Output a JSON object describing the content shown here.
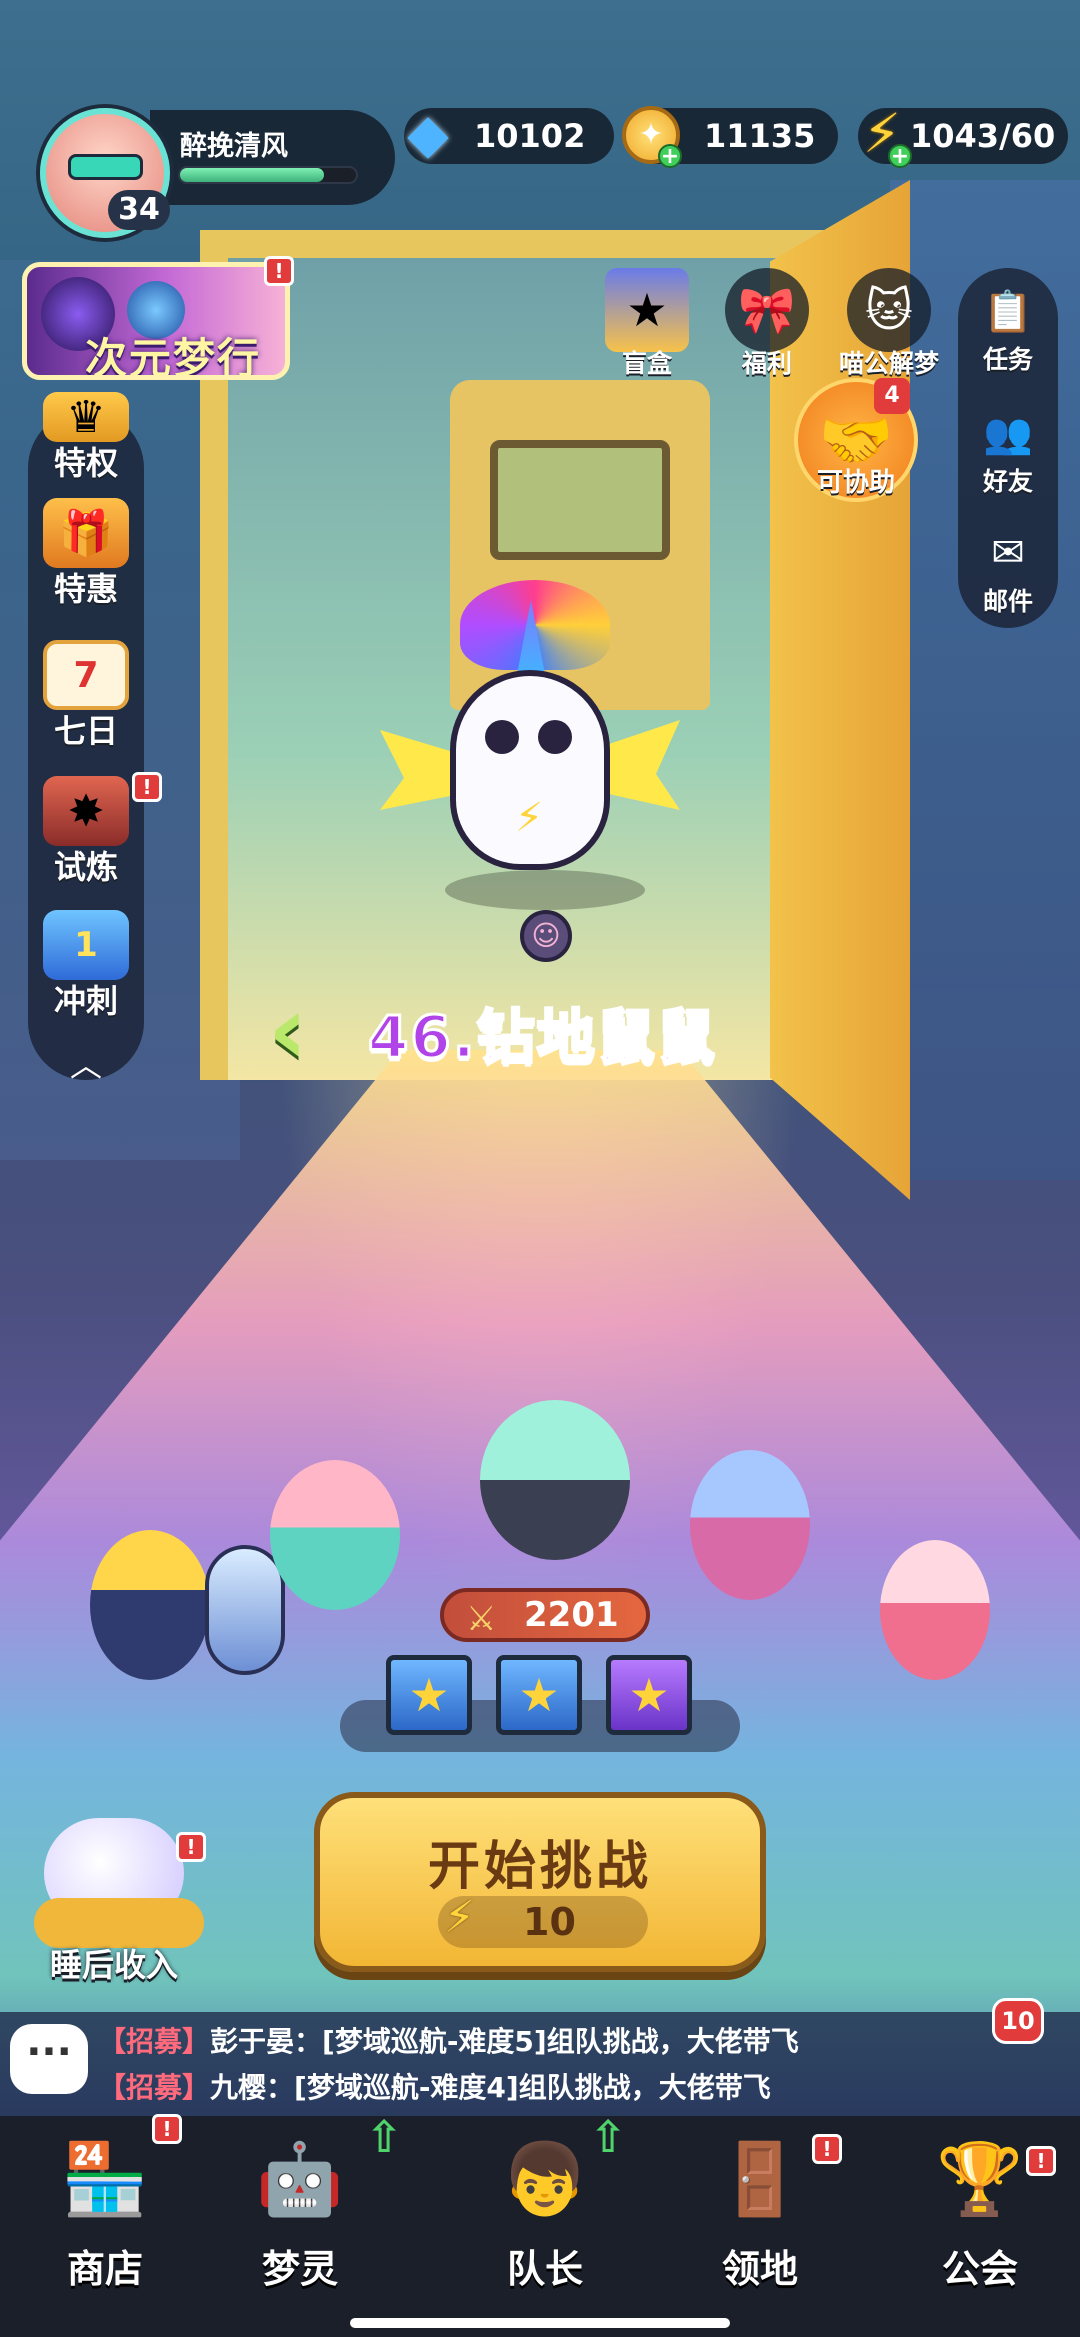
{
  "player": {
    "name": "醉挽清风",
    "level": "34",
    "hp_fraction": 0.82
  },
  "resources": {
    "gems": "10102",
    "coins": "11135",
    "energy": "1043/60"
  },
  "banner": {
    "label": "次元梦行"
  },
  "left_menu": [
    {
      "label": "特权",
      "icon": "crown-icon"
    },
    {
      "label": "特惠",
      "icon": "gift-box-icon"
    },
    {
      "label": "七日",
      "icon": "calendar-icon",
      "day": "7"
    },
    {
      "label": "试炼",
      "icon": "cannon-icon"
    },
    {
      "label": "冲刺",
      "icon": "trophy-icon",
      "rank": "1"
    }
  ],
  "top_icons": [
    {
      "label": "盲盒",
      "icon": "blind-box-icon"
    },
    {
      "label": "福利",
      "icon": "welfare-gift-icon"
    },
    {
      "label": "喵公解梦",
      "icon": "cat-icon"
    }
  ],
  "assist": {
    "label": "可协助",
    "count": "4"
  },
  "right_menu": [
    {
      "label": "任务",
      "icon": "task-icon"
    },
    {
      "label": "好友",
      "icon": "friends-icon"
    },
    {
      "label": "邮件",
      "icon": "mail-icon"
    }
  ],
  "stage": {
    "title": "46.钻地鼠鼠"
  },
  "team": {
    "power": "2201"
  },
  "challenge": {
    "label": "开始挑战",
    "cost": "10"
  },
  "sleep": {
    "label": "睡后收入"
  },
  "chat": {
    "count": "10",
    "lines": [
      {
        "tag": "【招募】",
        "text": "彭于晏：[梦域巡航-难度5]组队挑战，大佬带飞"
      },
      {
        "tag": "【招募】",
        "text": "九樱：[梦域巡航-难度4]组队挑战，大佬带飞"
      }
    ]
  },
  "nav": [
    {
      "label": "商店",
      "icon": "shop-icon"
    },
    {
      "label": "梦灵",
      "icon": "dream-spirit-icon"
    },
    {
      "label": "队长",
      "icon": "captain-icon"
    },
    {
      "label": "领地",
      "icon": "territory-icon"
    },
    {
      "label": "公会",
      "icon": "guild-icon"
    }
  ],
  "colors": {
    "accent": "#f2b634",
    "stage_title": "#b044e8",
    "badge": "#e23b3b"
  }
}
